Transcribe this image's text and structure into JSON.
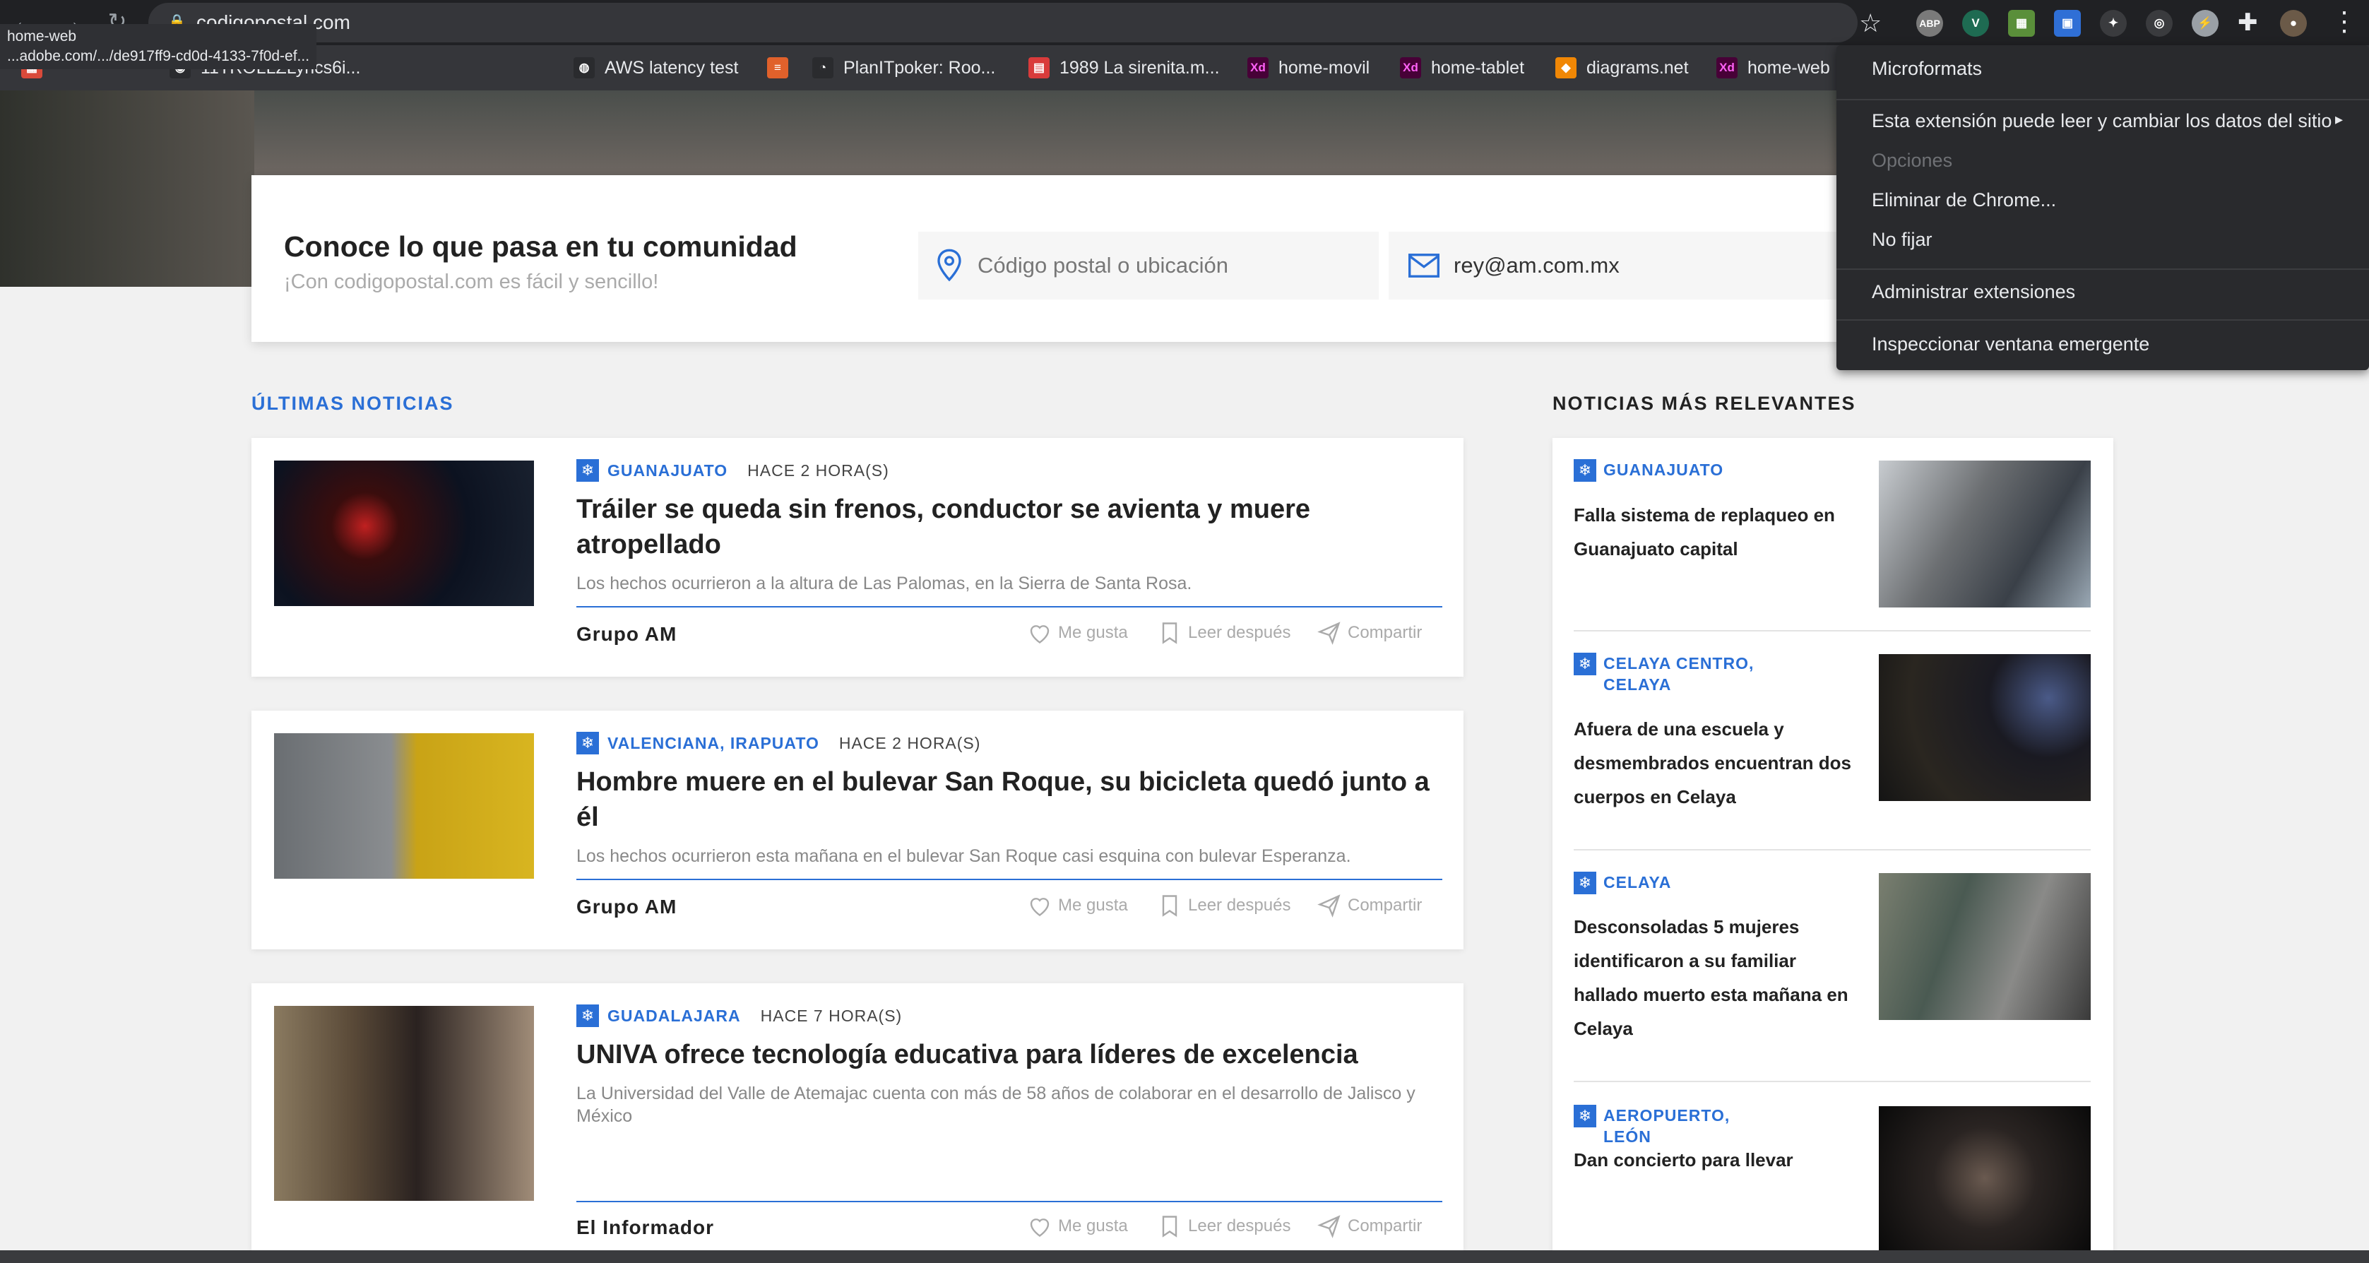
{
  "browser": {
    "url": "codigopostal.com",
    "tooltip": {
      "line1": "home-web",
      "line2": "...adobe.com/.../de917ff9-cd0d-4133-7f0d-ef..."
    },
    "bookmarks": [
      {
        "label": "11TROLLZLyrics6i...",
        "icon": "github-icon",
        "color": "#2a2b2e"
      },
      {
        "label": "AWS latency test",
        "icon": "globe-icon",
        "color": "#2a2b2e"
      },
      {
        "label": "",
        "icon": "stack-icon",
        "color": "#e0612b"
      },
      {
        "label": "PlanITpoker: Roo...",
        "icon": "poker-icon",
        "color": "#2a2b2e"
      },
      {
        "label": "1989 La sirenita.m...",
        "icon": "film-icon",
        "color": "#d93b3b"
      },
      {
        "label": "home-movil",
        "icon": "xd-icon",
        "color": "#470137"
      },
      {
        "label": "home-tablet",
        "icon": "xd-icon",
        "color": "#470137"
      },
      {
        "label": "diagrams.net",
        "icon": "diagrams-icon",
        "color": "#f08705"
      },
      {
        "label": "home-web",
        "icon": "xd-icon",
        "color": "#470137"
      }
    ],
    "ext_icons": {
      "abp": "ABP"
    }
  },
  "menu": {
    "items": [
      "Microformats",
      "Esta extensión puede leer y cambiar los datos del sitio",
      "Opciones",
      "Eliminar de Chrome...",
      "No fijar",
      "Administrar extensiones",
      "Inspeccionar ventana emergente"
    ]
  },
  "search": {
    "title": "Conoce lo que pasa en tu comunidad",
    "subtitle": "¡Con codigopostal.com es fácil y sencillo!",
    "location_placeholder": "Código postal o ubicación",
    "email_value": "rey@am.com.mx"
  },
  "latest": {
    "heading": "ÚLTIMAS NOTICIAS",
    "actions": {
      "like": "Me gusta",
      "later": "Leer después",
      "share": "Compartir"
    },
    "items": [
      {
        "category": "GUANAJUATO",
        "time": "HACE 2 HORA(S)",
        "title": "Tráiler se queda sin frenos, conductor se avienta y muere atropellado",
        "desc": "Los hechos ocurrieron a la altura de Las Palomas, en la Sierra de Santa Rosa.",
        "source": "Grupo AM"
      },
      {
        "category": "VALENCIANA, IRAPUATO",
        "time": "HACE 2 HORA(S)",
        "title": "Hombre muere en el bulevar San Roque, su bicicleta quedó junto a él",
        "desc": "Los hechos ocurrieron esta mañana en el bulevar San Roque casi esquina con bulevar Esperanza.",
        "source": "Grupo AM"
      },
      {
        "category": "GUADALAJARA",
        "time": "HACE 7 HORA(S)",
        "title": "UNIVA ofrece tecnología educativa para líderes de excelencia",
        "desc": "La Universidad del Valle de Atemajac cuenta con más de 58 años de colaborar en el desarrollo de Jalisco y México",
        "source": "El Informador"
      }
    ]
  },
  "relevant": {
    "heading": "NOTICIAS MÁS RELEVANTES",
    "items": [
      {
        "category": "GUANAJUATO",
        "title": "Falla sistema de replaqueo en Guanajuato capital"
      },
      {
        "category": "CELAYA CENTRO, CELAYA",
        "title": "Afuera de una escuela y desmembrados encuentran dos cuerpos en Celaya"
      },
      {
        "category": "CELAYA",
        "title": "Desconsoladas 5 mujeres identificaron a su familiar hallado muerto esta mañana en Celaya"
      },
      {
        "category": "AEROPUERTO, LEÓN",
        "title": "Dan concierto para llevar"
      }
    ]
  },
  "colors": {
    "accent": "#2a6fd6",
    "menu_bg": "#292a2d",
    "chrome_bg": "#202124"
  }
}
